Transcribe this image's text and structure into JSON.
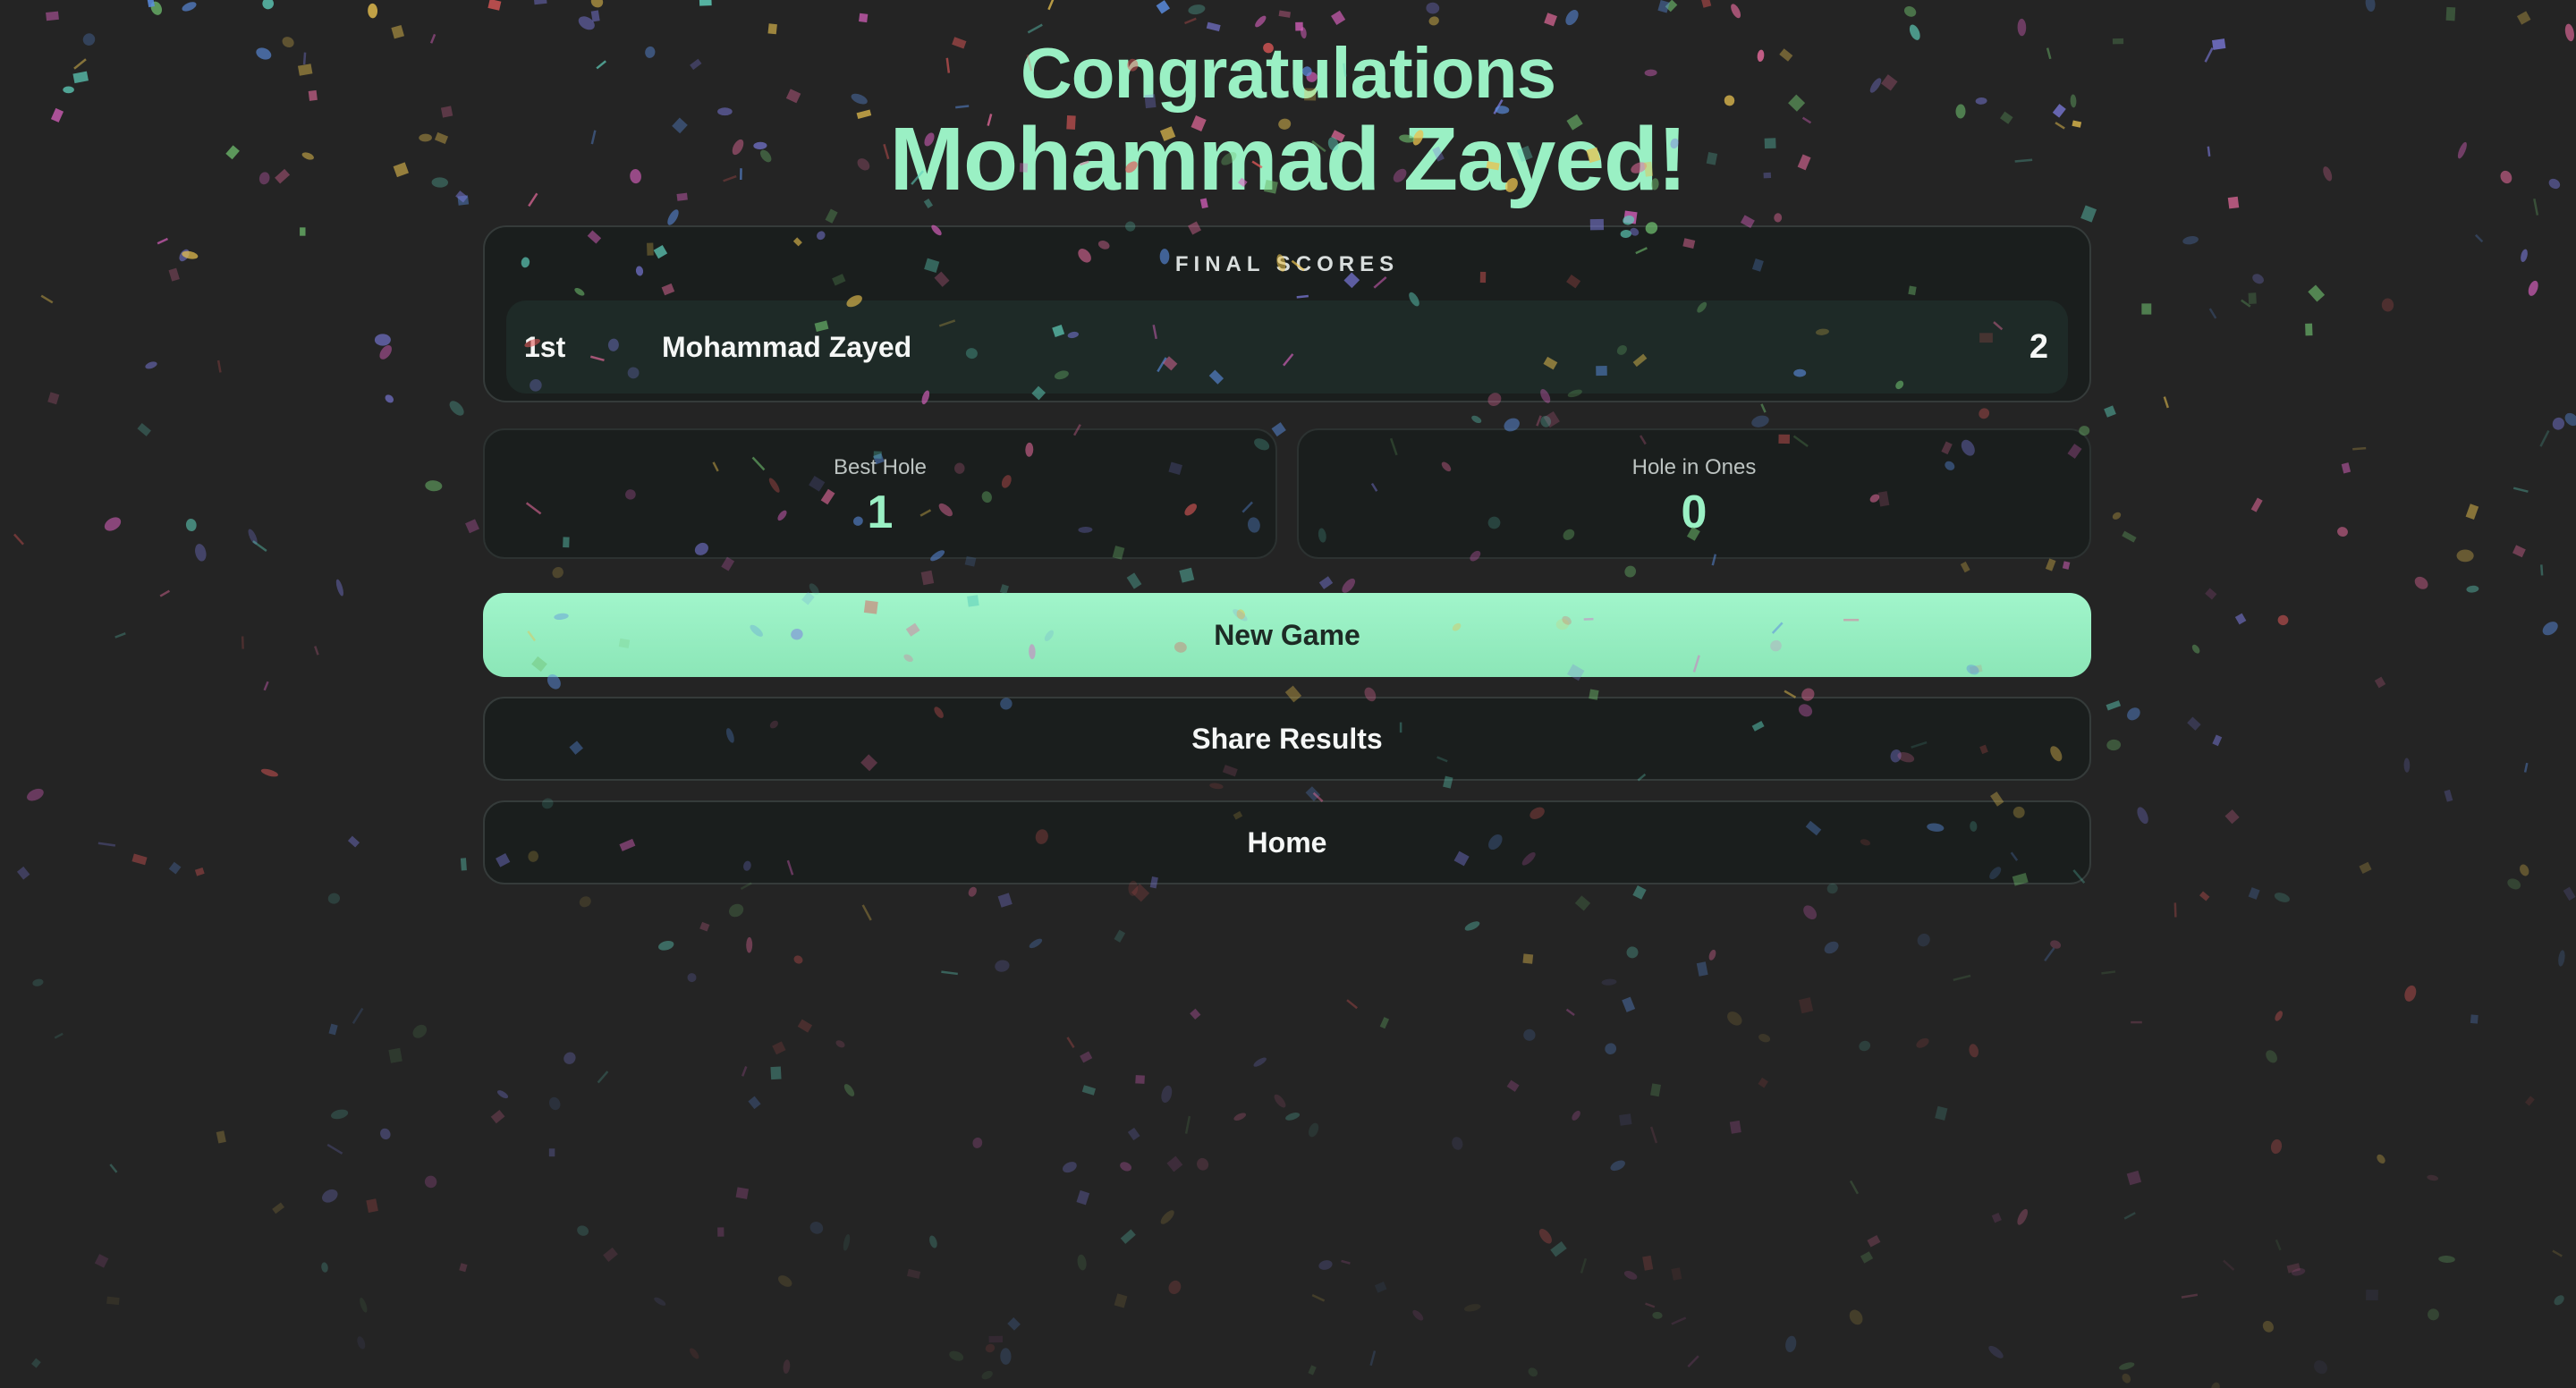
{
  "header": {
    "congrats": "Congratulations",
    "winner": "Mohammad Zayed!"
  },
  "final_scores": {
    "heading": "FINAL SCORES",
    "rows": [
      {
        "rank": "1st",
        "name": "Mohammad Zayed",
        "score": "2"
      }
    ]
  },
  "stats": {
    "best_hole": {
      "label": "Best Hole",
      "value": "1"
    },
    "hole_in_ones": {
      "label": "Hole in Ones",
      "value": "0"
    }
  },
  "actions": {
    "new_game": "New Game",
    "share_results": "Share Results",
    "home": "Home"
  },
  "theme": {
    "background": "#242424",
    "accent": "#9af0c4",
    "panel": "#1a1e1d",
    "confetti_colors": [
      "#e46a9b",
      "#5b8de0",
      "#e8c14f",
      "#5fcfbb",
      "#df63c4",
      "#e05858",
      "#6fbe6e",
      "#7d7ce0"
    ]
  }
}
